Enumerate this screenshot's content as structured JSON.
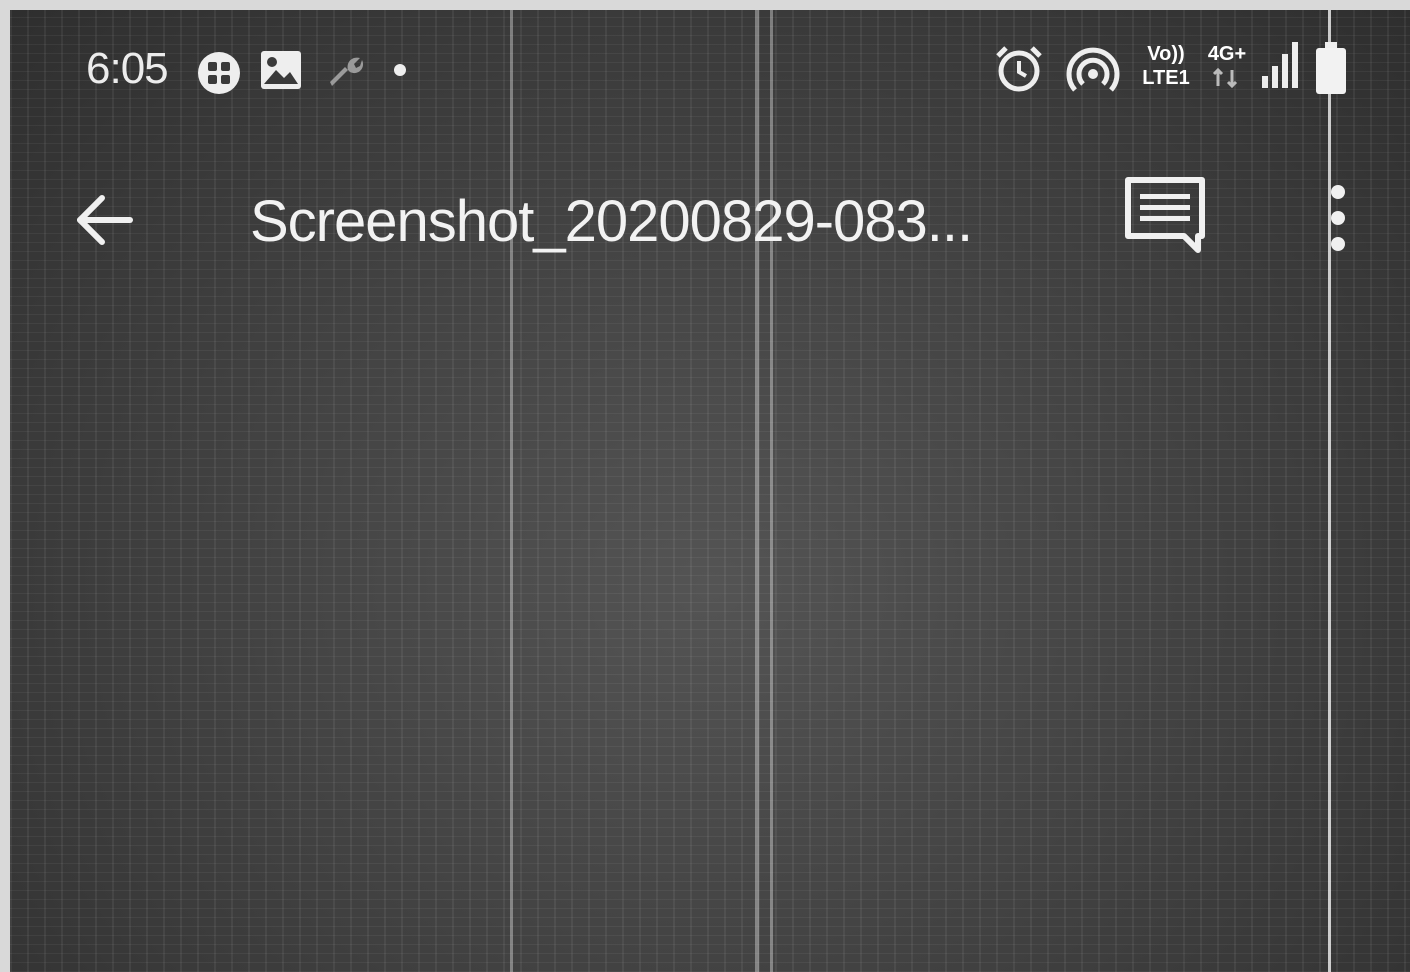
{
  "status_bar": {
    "time": "6:05",
    "network_volte": "Vo))",
    "network_lte": "LTE1",
    "network_4g": "4G+"
  },
  "app_bar": {
    "title": "Screenshot_20200829-083..."
  },
  "icons": {
    "status_left": [
      "grid-app-icon",
      "image-icon",
      "wrench-icon",
      "dot-icon"
    ],
    "status_right": [
      "alarm-icon",
      "hotspot-icon",
      "volte-lte-icon",
      "4g-icon",
      "signal-icon",
      "battery-icon"
    ],
    "app_bar": [
      "back-arrow-icon",
      "comment-icon",
      "more-vert-icon"
    ]
  }
}
